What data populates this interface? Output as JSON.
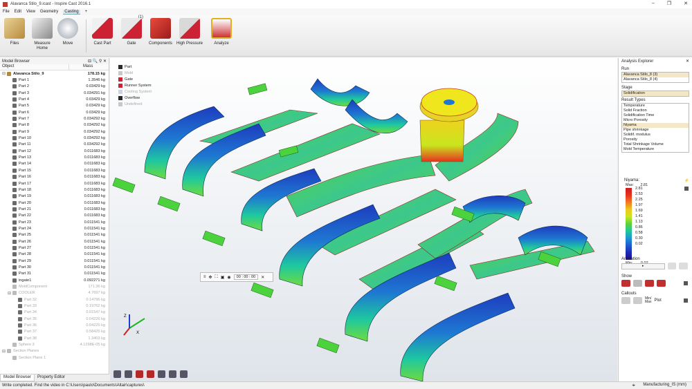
{
  "window": {
    "title": "Alavanca Stilo_9.icast - Inspire Cast 2016.1",
    "controls": [
      "–",
      "❐",
      "✕"
    ]
  },
  "menu": [
    "File",
    "Edit",
    "View",
    "Geometry",
    "Casting",
    "+"
  ],
  "ribbon": {
    "buttons": [
      {
        "label": "Files",
        "icon": "files-icon"
      },
      {
        "label": "Measure\nHome",
        "icon": "measure-icon"
      },
      {
        "label": "Move",
        "icon": "move-icon"
      },
      {
        "label": "Cast Part",
        "icon": "cast-part-icon"
      },
      {
        "label": "Gate",
        "icon": "gate-icon",
        "badge": "(1)"
      },
      {
        "label": "Components",
        "icon": "components-icon"
      },
      {
        "label": "High Pressure",
        "icon": "high-pressure-icon"
      },
      {
        "label": "Analyze",
        "icon": "analyze-icon"
      }
    ]
  },
  "model_browser": {
    "title": "Model Browser",
    "columns": [
      "Object",
      "Mass"
    ],
    "rows": [
      {
        "name": "Alavanca Stilo_9",
        "mass": "178.15 kg",
        "level": 0,
        "kind": "assembly",
        "bold": true
      },
      {
        "name": "Part 1",
        "mass": "1.3546 kg",
        "level": 1,
        "kind": "part"
      },
      {
        "name": "Part 2",
        "mass": "0.03429 kg",
        "level": 1,
        "kind": "part"
      },
      {
        "name": "Part 3",
        "mass": "0.034291 kg",
        "level": 1,
        "kind": "part"
      },
      {
        "name": "Part 4",
        "mass": "0.03429 kg",
        "level": 1,
        "kind": "part"
      },
      {
        "name": "Part 5",
        "mass": "0.03429 kg",
        "level": 1,
        "kind": "part"
      },
      {
        "name": "Part 6",
        "mass": "0.03429 kg",
        "level": 1,
        "kind": "part"
      },
      {
        "name": "Part 7",
        "mass": "0.034292 kg",
        "level": 1,
        "kind": "part"
      },
      {
        "name": "Part 8",
        "mass": "0.034292 kg",
        "level": 1,
        "kind": "part"
      },
      {
        "name": "Part 9",
        "mass": "0.034292 kg",
        "level": 1,
        "kind": "part"
      },
      {
        "name": "Part 10",
        "mass": "0.034292 kg",
        "level": 1,
        "kind": "part"
      },
      {
        "name": "Part 11",
        "mass": "0.034292 kg",
        "level": 1,
        "kind": "part"
      },
      {
        "name": "Part 12",
        "mass": "0.011683 kg",
        "level": 1,
        "kind": "part"
      },
      {
        "name": "Part 13",
        "mass": "0.011683 kg",
        "level": 1,
        "kind": "part"
      },
      {
        "name": "Part 14",
        "mass": "0.011683 kg",
        "level": 1,
        "kind": "part"
      },
      {
        "name": "Part 15",
        "mass": "0.011683 kg",
        "level": 1,
        "kind": "part"
      },
      {
        "name": "Part 16",
        "mass": "0.011683 kg",
        "level": 1,
        "kind": "part"
      },
      {
        "name": "Part 17",
        "mass": "0.011683 kg",
        "level": 1,
        "kind": "part"
      },
      {
        "name": "Part 18",
        "mass": "0.011683 kg",
        "level": 1,
        "kind": "part"
      },
      {
        "name": "Part 19",
        "mass": "0.011683 kg",
        "level": 1,
        "kind": "part"
      },
      {
        "name": "Part 20",
        "mass": "0.011683 kg",
        "level": 1,
        "kind": "part"
      },
      {
        "name": "Part 21",
        "mass": "0.011683 kg",
        "level": 1,
        "kind": "part"
      },
      {
        "name": "Part 22",
        "mass": "0.011683 kg",
        "level": 1,
        "kind": "part"
      },
      {
        "name": "Part 23",
        "mass": "0.011541 kg",
        "level": 1,
        "kind": "part"
      },
      {
        "name": "Part 24",
        "mass": "0.011541 kg",
        "level": 1,
        "kind": "part"
      },
      {
        "name": "Part 25",
        "mass": "0.011541 kg",
        "level": 1,
        "kind": "part"
      },
      {
        "name": "Part 26",
        "mass": "0.011541 kg",
        "level": 1,
        "kind": "part"
      },
      {
        "name": "Part 27",
        "mass": "0.011541 kg",
        "level": 1,
        "kind": "part"
      },
      {
        "name": "Part 28",
        "mass": "0.011541 kg",
        "level": 1,
        "kind": "part"
      },
      {
        "name": "Part 29",
        "mass": "0.011541 kg",
        "level": 1,
        "kind": "part"
      },
      {
        "name": "Part 30",
        "mass": "0.011541 kg",
        "level": 1,
        "kind": "part"
      },
      {
        "name": "Part 31",
        "mass": "0.011541 kg",
        "level": 1,
        "kind": "part"
      },
      {
        "name": "ingate1",
        "mass": "0.092271 kg",
        "level": 1,
        "kind": "part"
      },
      {
        "name": "MoldComponent",
        "mass": "171.36 kg",
        "level": 1,
        "kind": "mold",
        "dim": true
      },
      {
        "name": "COOLER",
        "mass": "4.7697 kg",
        "level": 1,
        "kind": "cooler",
        "dim": true
      },
      {
        "name": "Part 32",
        "mass": "0.14796 kg",
        "level": 2,
        "kind": "part",
        "dim": true
      },
      {
        "name": "Part 33",
        "mass": "0.19762 kg",
        "level": 2,
        "kind": "part",
        "dim": true
      },
      {
        "name": "Part 34",
        "mass": "0.01547 kg",
        "level": 2,
        "kind": "part",
        "dim": true
      },
      {
        "name": "Part 35",
        "mass": "0.04226 kg",
        "level": 2,
        "kind": "part",
        "dim": true
      },
      {
        "name": "Part 36",
        "mass": "0.04225 kg",
        "level": 2,
        "kind": "part",
        "dim": true
      },
      {
        "name": "Part 37",
        "mass": "0.58425 kg",
        "level": 2,
        "kind": "part",
        "dim": true
      },
      {
        "name": "Part 38",
        "mass": "1.3403 kg",
        "level": 2,
        "kind": "part",
        "dim": true
      },
      {
        "name": "Sphere 3",
        "mass": "4.1298E-05 kg",
        "level": 1,
        "kind": "sphere",
        "dim": true
      },
      {
        "name": "Section Planes",
        "mass": "",
        "level": 0,
        "kind": "folder",
        "dim": true
      },
      {
        "name": "Section Plane 1",
        "mass": "",
        "level": 1,
        "kind": "plane",
        "dim": true
      }
    ]
  },
  "bottom_tabs": [
    "Model Browser",
    "Property Editor"
  ],
  "viewport_legend": [
    {
      "label": "Part",
      "color": "#2a2a2a",
      "dim": false
    },
    {
      "label": "Mold",
      "color": "#c8c8c8",
      "dim": true
    },
    {
      "label": "Gate",
      "color": "#cc2233",
      "dim": false
    },
    {
      "label": "Runner System",
      "color": "#cc2233",
      "dim": false
    },
    {
      "label": "Cooling System",
      "color": "#c8d4e6",
      "dim": true
    },
    {
      "label": "Overflow",
      "color": "#2a2a2a",
      "dim": false
    },
    {
      "label": "Undefined",
      "color": "#c8c8c8",
      "dim": true
    }
  ],
  "playback": {
    "time": "00 : 00 : 00"
  },
  "analysis_explorer": {
    "title": "Analysis Explorer",
    "run_label": "Run",
    "runs": [
      "Alavanca Stilo_8 (3)",
      "Alavanca Stilo_8 (4)"
    ],
    "stage_label": "Stage",
    "stage": "Solidification",
    "result_types_label": "Result Types",
    "result_types": [
      "Temperature",
      "Solid Fraction",
      "Solidification Time",
      "Micro Porosity",
      "Niyama",
      "Pipe shrinkage",
      "Solidif. modulus",
      "Porosity",
      "Total Shrinkage Volume",
      "Mold Temperature"
    ],
    "selected_result": "Niyama",
    "scale_title": "Niyama:",
    "max_label": "Max:",
    "max_value": "2.81",
    "min_label": "Min:",
    "min_value": "0.02",
    "scale_ticks": [
      "2.81",
      "2.53",
      "2.25",
      "1.97",
      "1.69",
      "1.41",
      "1.13",
      "0.86",
      "0.58",
      "0.30",
      "0.02"
    ],
    "animation_label": "Animation",
    "show_label": "Show",
    "callouts_label": "Callouts",
    "callout_minmax": "Min/\nMax",
    "callout_plot": "Plot"
  },
  "statusbar": {
    "message": "Write completed. Find the video in C:\\Users\\paulo\\Documents\\Altair\\captures\\",
    "units": "Manufacturing_IS (mm)"
  }
}
